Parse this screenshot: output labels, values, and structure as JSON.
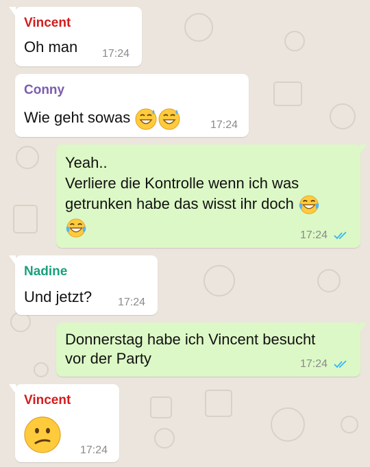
{
  "chat": {
    "messages": [
      {
        "sender": "Vincent",
        "text": "Oh man",
        "time": "17:24"
      },
      {
        "sender": "Conny",
        "text": "Wie geht sowas",
        "time": "17:24"
      },
      {
        "line1": "Yeah..",
        "line2": "Verliere die Kontrolle wenn ich was",
        "line3": "getrunken habe das wisst ihr doch",
        "time": "17:24",
        "status": "read"
      },
      {
        "sender": "Nadine",
        "text": "Und jetzt?",
        "time": "17:24"
      },
      {
        "line1": "Donnerstag habe ich Vincent besucht",
        "line2": "vor der Party",
        "time": "17:24",
        "status": "read"
      },
      {
        "sender": "Vincent",
        "time": "17:24"
      }
    ]
  },
  "colors": {
    "vincent": "#d31c1c",
    "conny": "#7a5cb0",
    "nadine": "#1aa07d",
    "incoming_bubble": "#ffffff",
    "outgoing_bubble": "#dcf8c6",
    "read_ticks": "#34b7f1",
    "wallpaper": "#ece5dd"
  },
  "icons": {
    "emoji_conny": "grinning-sweat-emoji",
    "emoji_self": "tears-of-joy-emoji",
    "emoji_vincent": "confused-face-emoji",
    "read_receipt": "double-check-icon"
  }
}
